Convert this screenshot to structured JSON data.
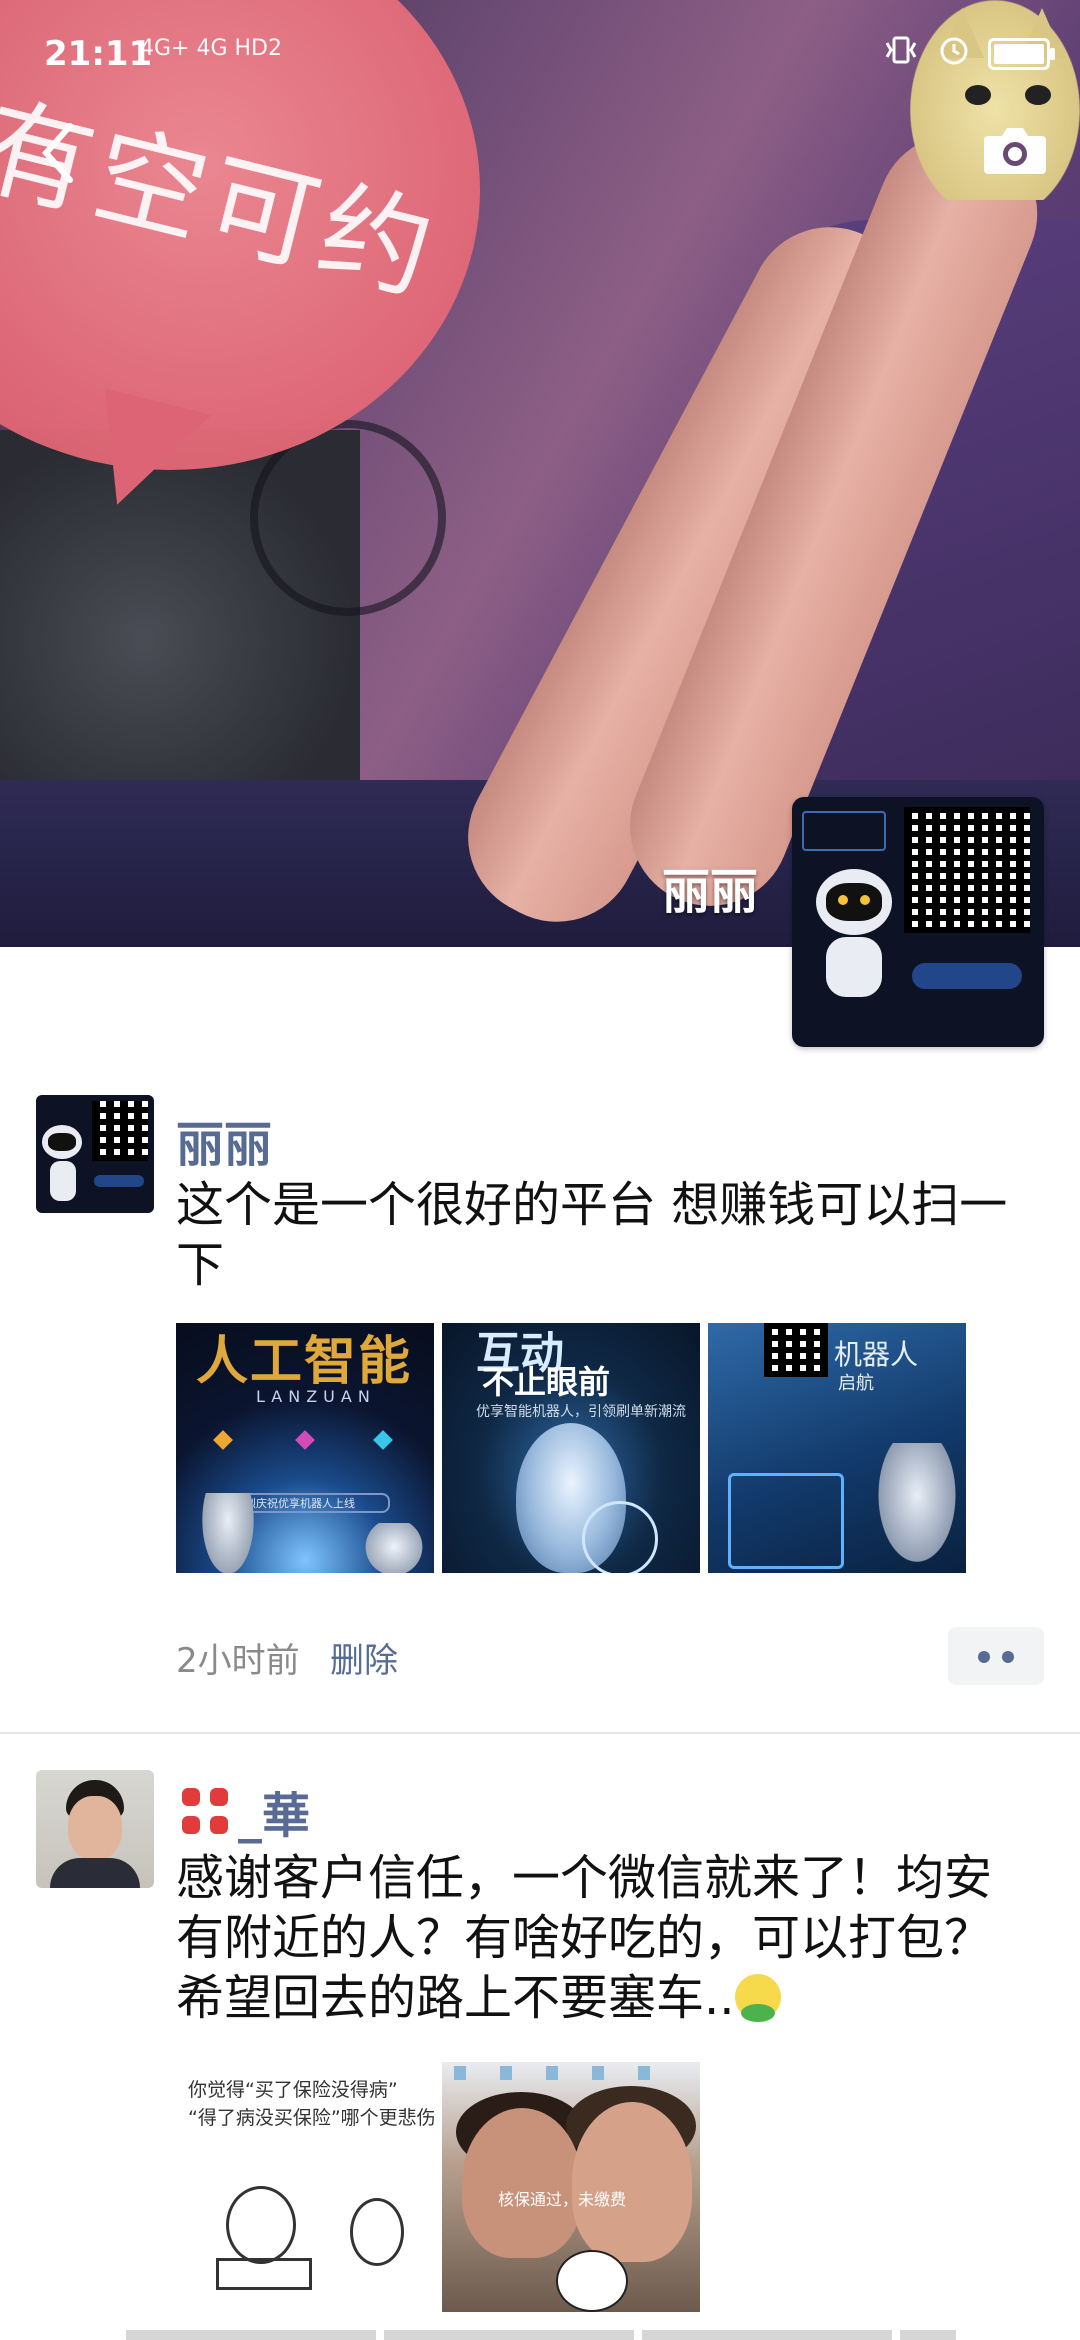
{
  "status_bar": {
    "time": "21:11",
    "network": "4G+ 4G HD2"
  },
  "cover": {
    "overlay_text": "有空可约",
    "name": "丽丽"
  },
  "posts": [
    {
      "name": "丽丽",
      "text": "这个是一个很好的平台 想赚钱可以扫一下",
      "time": "2小时前",
      "delete_label": "删除",
      "images": [
        {
          "title": "人工智能",
          "subtitle": "LANZUAN",
          "body": "热烈庆祝优享机器人上线"
        },
        {
          "title": "互动",
          "subtitle": "不止眼前",
          "body": "优享智能机器人，引领刷单新潮流"
        },
        {
          "title": "机器人",
          "subtitle": "启航"
        }
      ]
    },
    {
      "name": "_華",
      "text": "感谢客户信任，一个微信就来了！均安有附近的人？有啥好吃的，可以打包？希望回去的路上不要塞车..",
      "images": [
        {
          "caption_line1": "你觉得“买了保险没得病”",
          "caption_line2": "“得了病没买保险”哪个更悲伤"
        },
        {
          "label": "核保通过，未缴费"
        }
      ]
    }
  ],
  "icons": {
    "back": "back-arrow-icon",
    "camera": "camera-icon",
    "more": "more-dots-icon",
    "anger": "anger-emoji-icon",
    "smile": "smile-emoji-icon"
  },
  "colors": {
    "link_blue": "#576b95",
    "meta_gray": "#8a8a8a"
  }
}
